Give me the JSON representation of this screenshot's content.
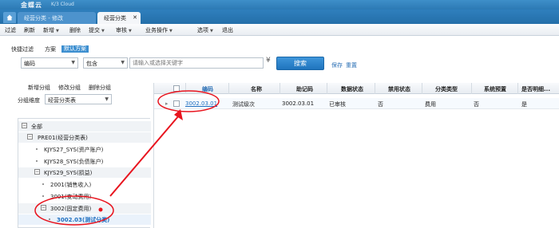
{
  "app": {
    "logo": "金蝶云",
    "logo_sub": "K/3 Cloud"
  },
  "tabs": [
    {
      "label": "经营分类 - 修改"
    },
    {
      "label": "经营分类"
    }
  ],
  "toolbar": [
    {
      "label": "过滤"
    },
    {
      "label": "刷新"
    },
    {
      "label": "新增"
    },
    {
      "label": "删除"
    },
    {
      "label": "提交"
    },
    {
      "label": "审核"
    },
    {
      "label": "业务操作"
    },
    {
      "label": "选项"
    },
    {
      "label": "退出"
    }
  ],
  "filter": {
    "quick_label": "快捷过滤",
    "scheme_label": "方案",
    "default_scheme": "默认方案",
    "field_value": "编码",
    "operator_value": "包含",
    "keyword_placeholder": "请输入或选择关键字",
    "search_label": "搜索",
    "save_label": "保存",
    "reset_label": "重置"
  },
  "left": {
    "add_group": "新增分组",
    "edit_group": "修改分组",
    "delete_group": "删除分组",
    "group_dim_label": "分组维度",
    "group_dim_value": "经营分类表"
  },
  "tree": [
    {
      "label": "全部"
    },
    {
      "label": "PRE01(经营分类表)"
    },
    {
      "label": "KJYS27_SYS(资产账户)"
    },
    {
      "label": "KJYS28_SYS(负债账户)"
    },
    {
      "label": "KJYS29_SYS(损益)"
    },
    {
      "label": "2001(销售收入)"
    },
    {
      "label": "3001(变动费用)"
    },
    {
      "label": "3002(固定费用)"
    },
    {
      "label": "3002.03(测试分类)"
    }
  ],
  "grid": {
    "columns": [
      "编码",
      "名称",
      "助记码",
      "数据状态",
      "禁用状态",
      "分类类型",
      "系统预置",
      "是否明细..."
    ],
    "rows": [
      {
        "code": "3002.03.01",
        "name": "测试级次",
        "mnemonic": "3002.03.01",
        "data_status": "已审核",
        "disabled": "否",
        "type": "费用",
        "preset": "否",
        "detail": "是"
      }
    ]
  },
  "colors": {
    "accent": "#2c79b4",
    "annotation": "#e8141e",
    "link": "#1f6fc0"
  }
}
